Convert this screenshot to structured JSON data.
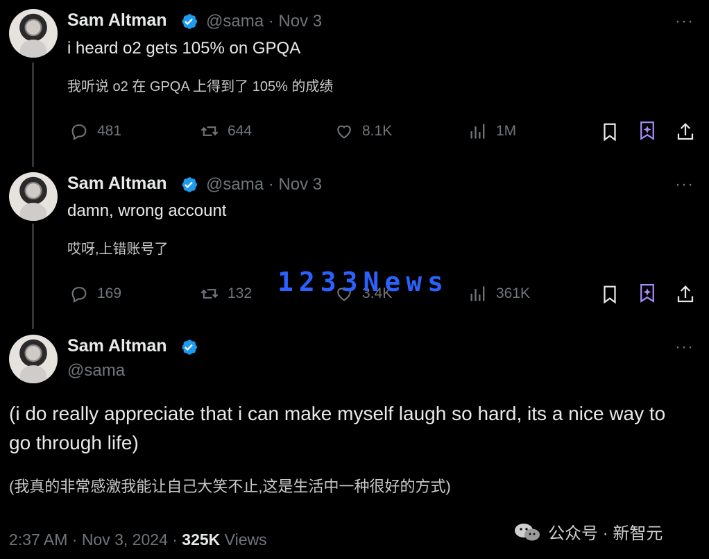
{
  "tweets": [
    {
      "name": "Sam Altman",
      "handle": "@sama",
      "date": "Nov 3",
      "text": "i heard o2 gets 105% on GPQA",
      "translation": "我听说 o2 在 GPQA 上得到了 105% 的成绩",
      "replies": "481",
      "reposts": "644",
      "likes": "8.1K",
      "views": "1M"
    },
    {
      "name": "Sam Altman",
      "handle": "@sama",
      "date": "Nov 3",
      "text": "damn, wrong account",
      "translation": "哎呀,上错账号了",
      "replies": "169",
      "reposts": "132",
      "likes": "3.4K",
      "views": "361K"
    }
  ],
  "main_tweet": {
    "name": "Sam Altman",
    "handle": "@sama",
    "text": "(i do really appreciate that i can make myself laugh so hard, its a nice way to go through life)",
    "translation": "(我真的非常感激我能让自己大笑不止,这是生活中一种很好的方式)",
    "time": "2:37 AM · Nov 3, 2024 · ",
    "views_count": "325K",
    "views_label": " Views"
  },
  "more_label": "···",
  "separator": " · ",
  "watermark": "1233News",
  "source_label": "公众号 · 新智元",
  "colors": {
    "background": "#000000",
    "text": "#e7e9ea",
    "secondary": "#71767b",
    "verified": "#1d9bf0",
    "grok": "#a78bfa"
  }
}
